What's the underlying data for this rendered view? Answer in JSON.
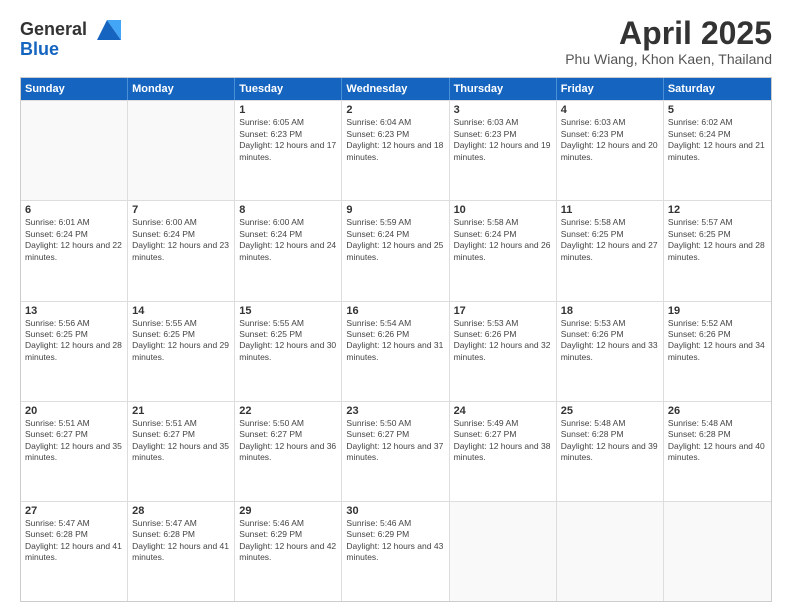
{
  "logo": {
    "general": "General",
    "blue": "Blue"
  },
  "header": {
    "title": "April 2025",
    "subtitle": "Phu Wiang, Khon Kaen, Thailand"
  },
  "weekdays": [
    "Sunday",
    "Monday",
    "Tuesday",
    "Wednesday",
    "Thursday",
    "Friday",
    "Saturday"
  ],
  "rows": [
    [
      {
        "day": "",
        "info": ""
      },
      {
        "day": "",
        "info": ""
      },
      {
        "day": "1",
        "info": "Sunrise: 6:05 AM\nSunset: 6:23 PM\nDaylight: 12 hours and 17 minutes."
      },
      {
        "day": "2",
        "info": "Sunrise: 6:04 AM\nSunset: 6:23 PM\nDaylight: 12 hours and 18 minutes."
      },
      {
        "day": "3",
        "info": "Sunrise: 6:03 AM\nSunset: 6:23 PM\nDaylight: 12 hours and 19 minutes."
      },
      {
        "day": "4",
        "info": "Sunrise: 6:03 AM\nSunset: 6:23 PM\nDaylight: 12 hours and 20 minutes."
      },
      {
        "day": "5",
        "info": "Sunrise: 6:02 AM\nSunset: 6:24 PM\nDaylight: 12 hours and 21 minutes."
      }
    ],
    [
      {
        "day": "6",
        "info": "Sunrise: 6:01 AM\nSunset: 6:24 PM\nDaylight: 12 hours and 22 minutes."
      },
      {
        "day": "7",
        "info": "Sunrise: 6:00 AM\nSunset: 6:24 PM\nDaylight: 12 hours and 23 minutes."
      },
      {
        "day": "8",
        "info": "Sunrise: 6:00 AM\nSunset: 6:24 PM\nDaylight: 12 hours and 24 minutes."
      },
      {
        "day": "9",
        "info": "Sunrise: 5:59 AM\nSunset: 6:24 PM\nDaylight: 12 hours and 25 minutes."
      },
      {
        "day": "10",
        "info": "Sunrise: 5:58 AM\nSunset: 6:24 PM\nDaylight: 12 hours and 26 minutes."
      },
      {
        "day": "11",
        "info": "Sunrise: 5:58 AM\nSunset: 6:25 PM\nDaylight: 12 hours and 27 minutes."
      },
      {
        "day": "12",
        "info": "Sunrise: 5:57 AM\nSunset: 6:25 PM\nDaylight: 12 hours and 28 minutes."
      }
    ],
    [
      {
        "day": "13",
        "info": "Sunrise: 5:56 AM\nSunset: 6:25 PM\nDaylight: 12 hours and 28 minutes."
      },
      {
        "day": "14",
        "info": "Sunrise: 5:55 AM\nSunset: 6:25 PM\nDaylight: 12 hours and 29 minutes."
      },
      {
        "day": "15",
        "info": "Sunrise: 5:55 AM\nSunset: 6:25 PM\nDaylight: 12 hours and 30 minutes."
      },
      {
        "day": "16",
        "info": "Sunrise: 5:54 AM\nSunset: 6:26 PM\nDaylight: 12 hours and 31 minutes."
      },
      {
        "day": "17",
        "info": "Sunrise: 5:53 AM\nSunset: 6:26 PM\nDaylight: 12 hours and 32 minutes."
      },
      {
        "day": "18",
        "info": "Sunrise: 5:53 AM\nSunset: 6:26 PM\nDaylight: 12 hours and 33 minutes."
      },
      {
        "day": "19",
        "info": "Sunrise: 5:52 AM\nSunset: 6:26 PM\nDaylight: 12 hours and 34 minutes."
      }
    ],
    [
      {
        "day": "20",
        "info": "Sunrise: 5:51 AM\nSunset: 6:27 PM\nDaylight: 12 hours and 35 minutes."
      },
      {
        "day": "21",
        "info": "Sunrise: 5:51 AM\nSunset: 6:27 PM\nDaylight: 12 hours and 35 minutes."
      },
      {
        "day": "22",
        "info": "Sunrise: 5:50 AM\nSunset: 6:27 PM\nDaylight: 12 hours and 36 minutes."
      },
      {
        "day": "23",
        "info": "Sunrise: 5:50 AM\nSunset: 6:27 PM\nDaylight: 12 hours and 37 minutes."
      },
      {
        "day": "24",
        "info": "Sunrise: 5:49 AM\nSunset: 6:27 PM\nDaylight: 12 hours and 38 minutes."
      },
      {
        "day": "25",
        "info": "Sunrise: 5:48 AM\nSunset: 6:28 PM\nDaylight: 12 hours and 39 minutes."
      },
      {
        "day": "26",
        "info": "Sunrise: 5:48 AM\nSunset: 6:28 PM\nDaylight: 12 hours and 40 minutes."
      }
    ],
    [
      {
        "day": "27",
        "info": "Sunrise: 5:47 AM\nSunset: 6:28 PM\nDaylight: 12 hours and 41 minutes."
      },
      {
        "day": "28",
        "info": "Sunrise: 5:47 AM\nSunset: 6:28 PM\nDaylight: 12 hours and 41 minutes."
      },
      {
        "day": "29",
        "info": "Sunrise: 5:46 AM\nSunset: 6:29 PM\nDaylight: 12 hours and 42 minutes."
      },
      {
        "day": "30",
        "info": "Sunrise: 5:46 AM\nSunset: 6:29 PM\nDaylight: 12 hours and 43 minutes."
      },
      {
        "day": "",
        "info": ""
      },
      {
        "day": "",
        "info": ""
      },
      {
        "day": "",
        "info": ""
      }
    ]
  ]
}
